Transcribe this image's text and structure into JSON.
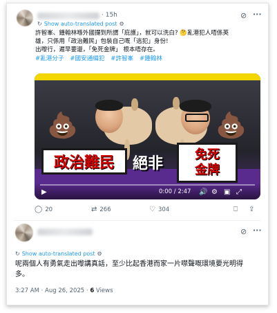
{
  "tweet": {
    "time_ago": "15h",
    "translated_label": "Show auto-translated post",
    "text_lines": [
      "許智峯、鍾翰林喺外國攞到所謂「庇護」，就可以洗白? 🤔亂港犯人唔係英",
      "雄，只係用「政治難民」包裝自己嘅「逃犯」身份!",
      "出嚟行，遲早要還，「免死金牌」 根本唔存在。"
    ],
    "hashtags": [
      "#亂港分子",
      "#國安通緝犯",
      "#許智峯",
      "#鍾翰林"
    ],
    "video": {
      "caption_left": "政治難民",
      "caption_mid": "絕非",
      "caption_right_top": "免死",
      "caption_right_bottom": "金牌",
      "time": "0:00 / 2:47",
      "progress": 0
    },
    "actions": {
      "replies": "20",
      "reposts": "266",
      "likes": "304"
    }
  },
  "reply": {
    "translated_label": "Show auto-translated post",
    "text": "呢兩個人有勇氣走出嚟講真話，至少比起香港而家一片噤聲嘅環境要光明得多。",
    "timestamp": "3:27 AM · Aug 26, 2025 · ",
    "views_count": "6",
    "views_label": " Views"
  },
  "icons": {
    "grok": "grok-icon",
    "more": "more-icon",
    "reply": "reply-icon",
    "repost": "repost-icon",
    "like": "like-icon",
    "bookmark": "bookmark-icon",
    "share": "share-icon"
  },
  "colors": {
    "accent": "#1d9bf0",
    "text": "#0f1419",
    "muted": "#536471"
  }
}
